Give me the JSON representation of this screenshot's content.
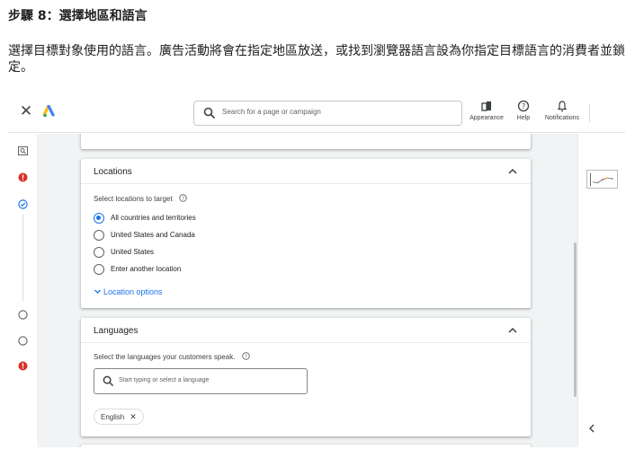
{
  "step": {
    "title": "步驟 8：選擇地區和語言",
    "description": "選擇目標對象使用的語言。廣告活動將會在指定地區放送，或找到瀏覽器語言設為你指定目標語言的消費者並鎖定。"
  },
  "topbar": {
    "search_placeholder": "Search for a page or campaign",
    "appearance_label": "Appearance",
    "help_label": "Help",
    "notifications_label": "Notifications"
  },
  "locations": {
    "title": "Locations",
    "subtitle": "Select locations to target",
    "options": [
      {
        "label": "All countries and territories",
        "selected": true
      },
      {
        "label": "United States and Canada",
        "selected": false
      },
      {
        "label": "United States",
        "selected": false
      },
      {
        "label": "Enter another location",
        "selected": false
      }
    ],
    "options_link": "Location options"
  },
  "languages": {
    "title": "Languages",
    "subtitle": "Select the languages your customers speak.",
    "input_placeholder": "Start typing or select a language",
    "chips": [
      "English"
    ]
  },
  "colors": {
    "accent": "#1a73e8",
    "error": "#d93025",
    "background": "#f1f3f4"
  }
}
